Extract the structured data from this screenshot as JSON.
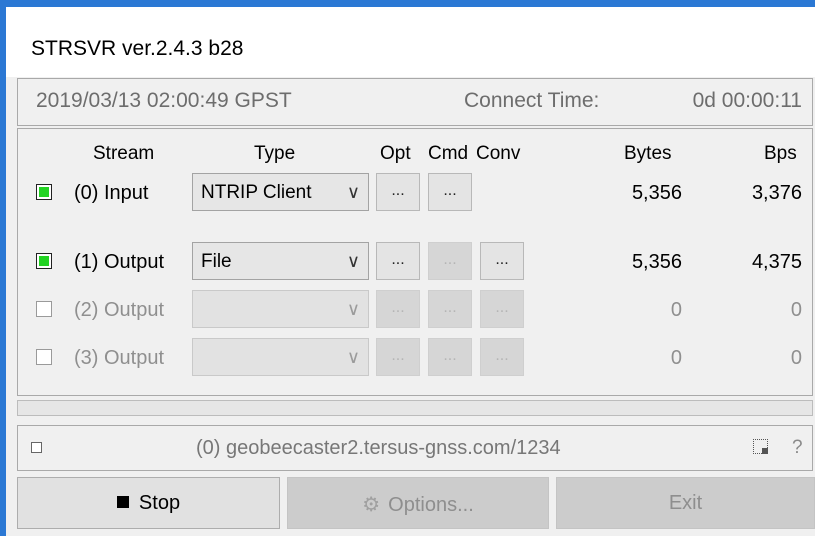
{
  "window": {
    "title": "STRSVR ver.2.4.3 b28"
  },
  "status": {
    "datetime": "2019/03/13 02:00:49 GPST",
    "connect_label": "Connect Time:",
    "connect_value": "0d 00:00:11"
  },
  "headers": {
    "stream": "Stream",
    "type": "Type",
    "opt": "Opt",
    "cmd": "Cmd",
    "conv": "Conv",
    "bytes": "Bytes",
    "bps": "Bps"
  },
  "streams": [
    {
      "checked": true,
      "label": "(0) Input",
      "type": "NTRIP Client",
      "opt": "...",
      "cmd": "...",
      "conv": "",
      "bytes": "5,356",
      "bps": "3,376"
    },
    {
      "checked": true,
      "label": "(1) Output",
      "type": "File",
      "opt": "...",
      "cmd": "...",
      "conv": "...",
      "bytes": "5,356",
      "bps": "4,375"
    },
    {
      "checked": false,
      "label": "(2) Output",
      "type": "",
      "opt": "...",
      "cmd": "...",
      "conv": "...",
      "bytes": "0",
      "bps": "0"
    },
    {
      "checked": false,
      "label": "(3) Output",
      "type": "",
      "opt": "...",
      "cmd": "...",
      "conv": "...",
      "bytes": "0",
      "bps": "0"
    }
  ],
  "combo_arrow": "∨",
  "message": {
    "text": "(0) geobeecaster2.tersus-gnss.com/1234",
    "help": "?"
  },
  "buttons": {
    "stop": "Stop",
    "stop_icon": "stop-square-icon",
    "options": "Options...",
    "options_icon": "gear-icon",
    "exit": "Exit"
  }
}
